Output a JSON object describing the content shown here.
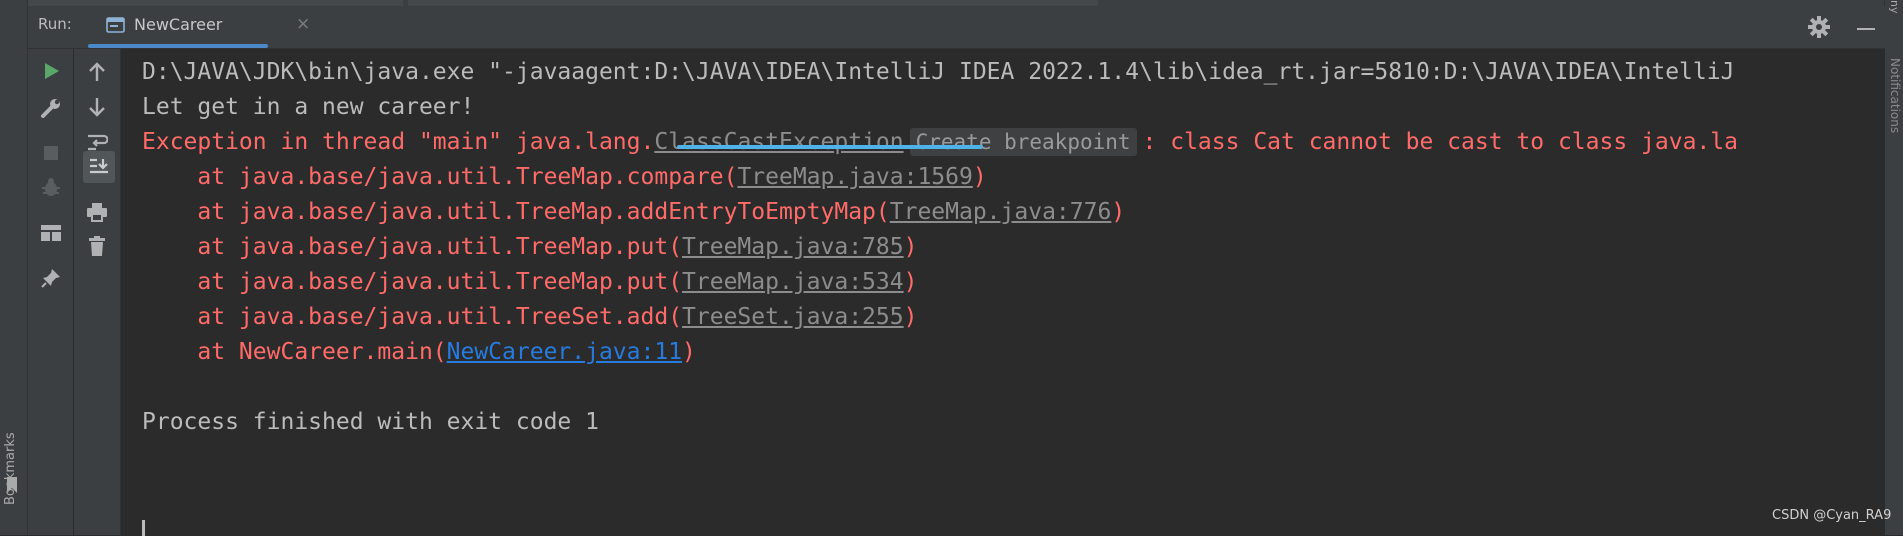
{
  "header": {
    "run_label": "Run:",
    "tab_label": "NewCareer",
    "tab_close": "×"
  },
  "left_stripe": {
    "bookmarks_label": "Bookmarks"
  },
  "right_stripe": {
    "notifications_label": "Notifications",
    "top_fragment": "ny"
  },
  "console": {
    "command_line": "D:\\JAVA\\JDK\\bin\\java.exe \"-javaagent:D:\\JAVA\\IDEA\\IntelliJ IDEA 2022.1.4\\lib\\idea_rt.jar=5810:D:\\JAVA\\IDEA\\IntelliJ",
    "output_line": "Let get in a new career!",
    "exception": {
      "prefix": "Exception in thread \"main\" java.lang.",
      "class_link": "ClassCastException",
      "hint": "Create breakpoint",
      "suffix": ": class Cat cannot be cast to class java.la"
    },
    "stack": [
      {
        "prefix": "    at java.base/java.util.TreeMap.compare(",
        "link": "TreeMap.java:1569",
        "suffix": ")",
        "link_color": "gray"
      },
      {
        "prefix": "    at java.base/java.util.TreeMap.addEntryToEmptyMap(",
        "link": "TreeMap.java:776",
        "suffix": ")",
        "link_color": "gray"
      },
      {
        "prefix": "    at java.base/java.util.TreeMap.put(",
        "link": "TreeMap.java:785",
        "suffix": ")",
        "link_color": "gray"
      },
      {
        "prefix": "    at java.base/java.util.TreeMap.put(",
        "link": "TreeMap.java:534",
        "suffix": ")",
        "link_color": "gray"
      },
      {
        "prefix": "    at java.base/java.util.TreeSet.add(",
        "link": "TreeSet.java:255",
        "suffix": ")",
        "link_color": "gray"
      },
      {
        "prefix": "    at NewCareer.main(",
        "link": "NewCareer.java:11",
        "suffix": ")",
        "link_color": "blue"
      }
    ],
    "exit_line": "Process finished with exit code 1"
  },
  "watermark": "CSDN @Cyan_RA9",
  "colors": {
    "error": "#ff6b68",
    "text": "#bbbbbb",
    "link_blue": "#287bde",
    "link_gray": "#8c8c8c",
    "run_green": "#59a869",
    "tab_underline": "#4a88c7",
    "highlight_wave": "#4fb3e8"
  },
  "toolbar_icons": [
    "rerun-icon",
    "modify-config-icon",
    "stop-icon",
    "debug-icon",
    "layout-icon",
    "pin-icon",
    "up-arrow-icon",
    "down-arrow-icon",
    "soft-wrap-icon",
    "scroll-to-end-icon",
    "print-icon",
    "trash-icon"
  ]
}
